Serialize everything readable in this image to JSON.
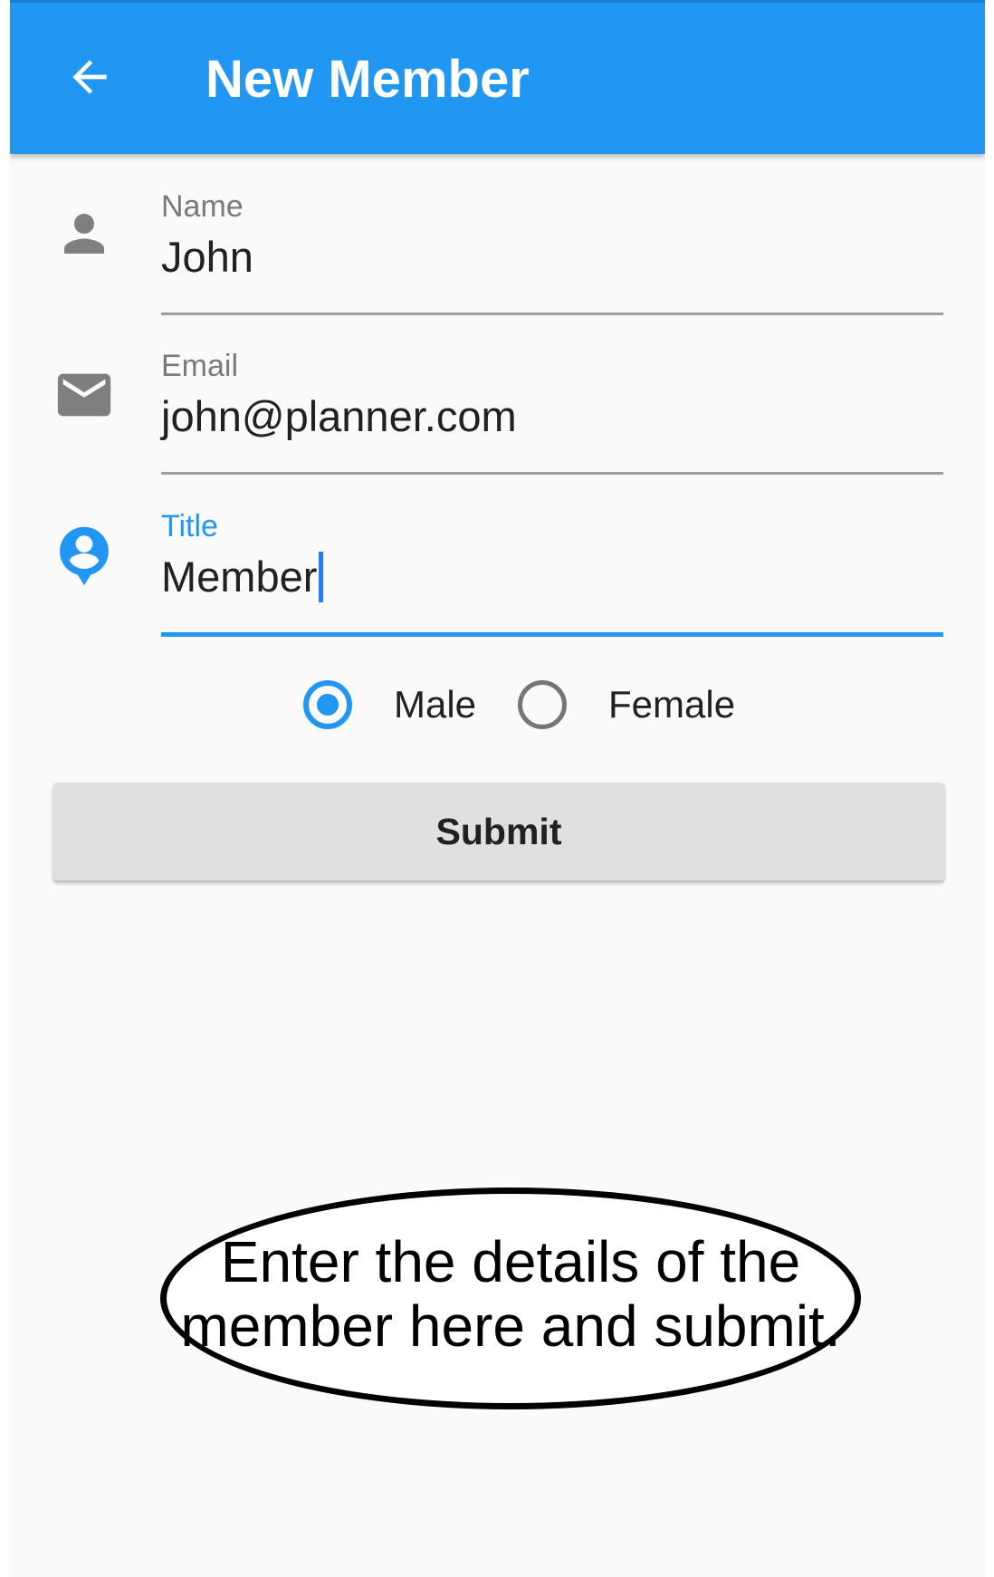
{
  "app_bar": {
    "title": "New Member",
    "back_icon": "arrow-back-icon",
    "background_color": "#2196f3"
  },
  "form": {
    "name": {
      "label": "Name",
      "value": "John",
      "icon": "person-icon"
    },
    "email": {
      "label": "Email",
      "value": "john@planner.com",
      "icon": "mail-icon"
    },
    "title": {
      "label": "Title",
      "value": "Member",
      "icon": "account-circle-icon",
      "focused": true
    },
    "gender": {
      "options": [
        {
          "label": "Male",
          "selected": true
        },
        {
          "label": "Female",
          "selected": false
        }
      ]
    },
    "submit_label": "Submit"
  },
  "callout": {
    "line1": "Enter the details of the",
    "line2": "member here and submit."
  },
  "colors": {
    "accent": "#2196f3",
    "icon_gray": "#7f7f7f",
    "button_bg": "#e0e0e0"
  }
}
